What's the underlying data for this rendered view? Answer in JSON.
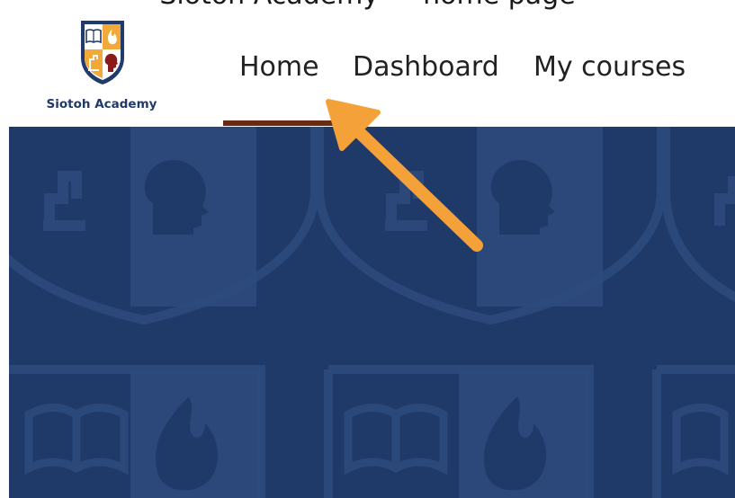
{
  "caption": {
    "text": "Siotoh Academy — home page"
  },
  "brand": {
    "name": "Siotoh Academy",
    "logo_icon": "academy-shield-logo"
  },
  "nav": {
    "items": [
      {
        "label": "Home",
        "active": true
      },
      {
        "label": "Dashboard",
        "active": false
      },
      {
        "label": "My courses",
        "active": false
      }
    ]
  },
  "banner": {
    "pattern_icons": [
      "microscope-icon",
      "head-profile-icon",
      "book-icon",
      "flame-icon"
    ]
  },
  "annotation": {
    "arrow_icon": "pointer-arrow-icon",
    "target": "Home"
  },
  "colors": {
    "banner": "#1f3a68",
    "active_underline": "#6b2a12",
    "arrow": "#f5a13a",
    "brand_text": "#1f3a6b"
  }
}
